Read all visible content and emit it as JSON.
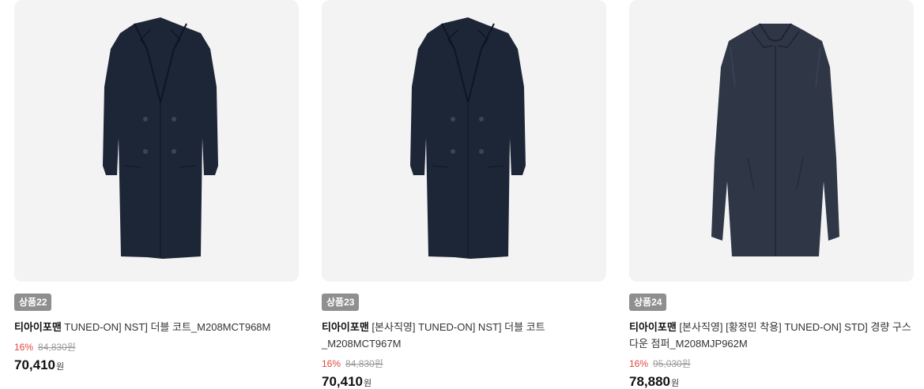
{
  "products": [
    {
      "badge": "상품22",
      "brand": "티아이포맨",
      "name": " TUNED-ON] NST] 더블 코트_M208MCT968M",
      "discount": "16%",
      "original_price": "84,830원",
      "sale_price": "70,410",
      "currency": "원",
      "image_icon": "double-breasted-coat-image"
    },
    {
      "badge": "상품23",
      "brand": "티아이포맨",
      "name": " [본사직영] TUNED-ON] NST] 더블 코트",
      "name_line2": "_M208MCT967M",
      "discount": "16%",
      "original_price": "84,830원",
      "sale_price": "70,410",
      "currency": "원",
      "image_icon": "double-breasted-coat-image"
    },
    {
      "badge": "상품24",
      "brand": "티아이포맨",
      "name": " [본사직영] [황정민 착용] TUNED-ON] STD] 경량 구스",
      "name_line2": "다운 점퍼_M208MJP962M",
      "discount": "16%",
      "original_price": "95,030원",
      "sale_price": "78,880",
      "currency": "원",
      "image_icon": "down-jacket-coat-image"
    }
  ],
  "colors": {
    "discount": "#e2463a",
    "badge_bg": "#8f8f8f",
    "coat_navy": "#1c2535",
    "jacket_navy": "#2f3646"
  }
}
